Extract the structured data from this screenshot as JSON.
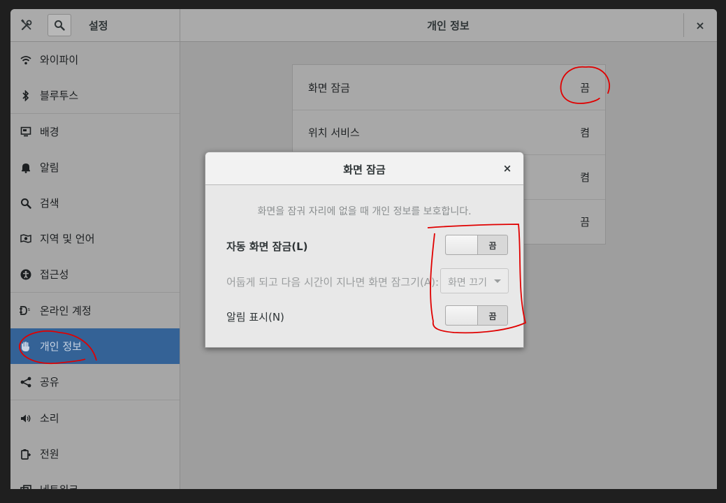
{
  "header": {
    "sidebar_title": "설정",
    "panel_title": "개인 정보",
    "close_symbol": "×"
  },
  "sidebar": {
    "items": [
      {
        "label": "와이파이",
        "icon": "wifi-icon"
      },
      {
        "label": "블루투스",
        "icon": "bluetooth-icon"
      },
      {
        "label": "배경",
        "icon": "background-icon"
      },
      {
        "label": "알림",
        "icon": "bell-icon"
      },
      {
        "label": "검색",
        "icon": "search-icon"
      },
      {
        "label": "지역 및 언어",
        "icon": "region-icon"
      },
      {
        "label": "접근성",
        "icon": "accessibility-icon"
      },
      {
        "label": "온라인 계정",
        "icon": "online-accounts-icon"
      },
      {
        "label": "개인 정보",
        "icon": "hand-icon",
        "selected": true
      },
      {
        "label": "공유",
        "icon": "share-icon"
      },
      {
        "label": "소리",
        "icon": "speaker-icon"
      },
      {
        "label": "전원",
        "icon": "power-icon"
      },
      {
        "label": "네트워크",
        "icon": "network-icon"
      }
    ]
  },
  "privacy": {
    "rows": [
      {
        "label": "화면 잠금",
        "value": "끔"
      },
      {
        "label": "위치 서비스",
        "value": "켬"
      },
      {
        "label": "",
        "value": "켬"
      },
      {
        "label": "",
        "value": "끔"
      }
    ]
  },
  "dialog": {
    "title": "화면 잠금",
    "close_symbol": "×",
    "description": "화면을 잠궈 자리에 없을 때 개인 정보를 보호합니다.",
    "auto_lock_label": "자동 화면 잠금(L)",
    "auto_lock_state": "끔",
    "delay_label": "어둡게 되고 다음 시간이 지나면 화면 잠그기(A):",
    "delay_value": "화면 끄기",
    "notifications_label": "알림 표시(N)",
    "notifications_state": "끔"
  },
  "colors": {
    "selected_bg": "#346296",
    "annotation": "#e00000"
  }
}
